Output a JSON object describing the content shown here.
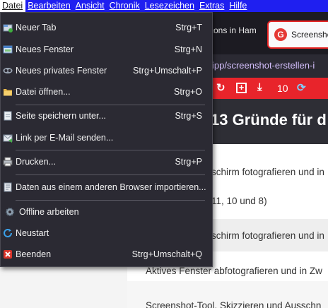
{
  "menubar": {
    "items": [
      {
        "label": "Datei",
        "underline": 0
      },
      {
        "label": "Bearbeiten",
        "underline": 0
      },
      {
        "label": "Ansicht",
        "underline": 0
      },
      {
        "label": "Chronik",
        "underline": 0
      },
      {
        "label": "Lesezeichen",
        "underline": 0
      },
      {
        "label": "Extras",
        "underline": 0
      },
      {
        "label": "Hilfe",
        "underline": 0
      }
    ],
    "bar_color": "#1f1ff0"
  },
  "background": {
    "tab_inactive": "cons in Ham",
    "tab_active": "Screensho",
    "url_prefix": "",
    "url_text": "ipp/screenshot-erstellen-i",
    "toolbar_count": "10",
    "heading": "13 Gründe für d",
    "lines": [
      "schirm fotografieren und in",
      "11, 10 und 8)",
      "schirm fotografieren und in",
      "Aktives Fenster abfotografieren und in Zw",
      "Screenshot-Tool, Skizzieren und Ausschn"
    ],
    "toolbar_color": "#e8242b"
  },
  "menu": {
    "items": [
      {
        "label": "Neuer Tab",
        "shortcut": "Strg+T",
        "icon": "new-tab-icon"
      },
      {
        "label": "Neues Fenster",
        "shortcut": "Strg+N",
        "icon": "new-window-icon"
      },
      {
        "label": "Neues privates Fenster",
        "shortcut": "Strg+Umschalt+P",
        "icon": "private-window-icon"
      },
      {
        "label": "Datei öffnen...",
        "shortcut": "Strg+O",
        "icon": "folder-open-icon"
      },
      {
        "label": "Seite speichern unter...",
        "shortcut": "Strg+S",
        "icon": "save-page-icon"
      },
      {
        "label": "Link per E-Mail senden...",
        "shortcut": "",
        "icon": "email-link-icon"
      },
      {
        "label": "Drucken...",
        "shortcut": "Strg+P",
        "icon": "printer-icon"
      },
      {
        "label": "Daten aus einem anderen Browser importieren...",
        "shortcut": "",
        "icon": "import-icon"
      },
      {
        "label": "Offline arbeiten",
        "shortcut": "",
        "icon": "offline-gear-icon"
      },
      {
        "label": "Neustart",
        "shortcut": "",
        "icon": "restart-icon"
      },
      {
        "label": "Beenden",
        "shortcut": "Strg+Umschalt+Q",
        "icon": "quit-icon"
      }
    ]
  }
}
